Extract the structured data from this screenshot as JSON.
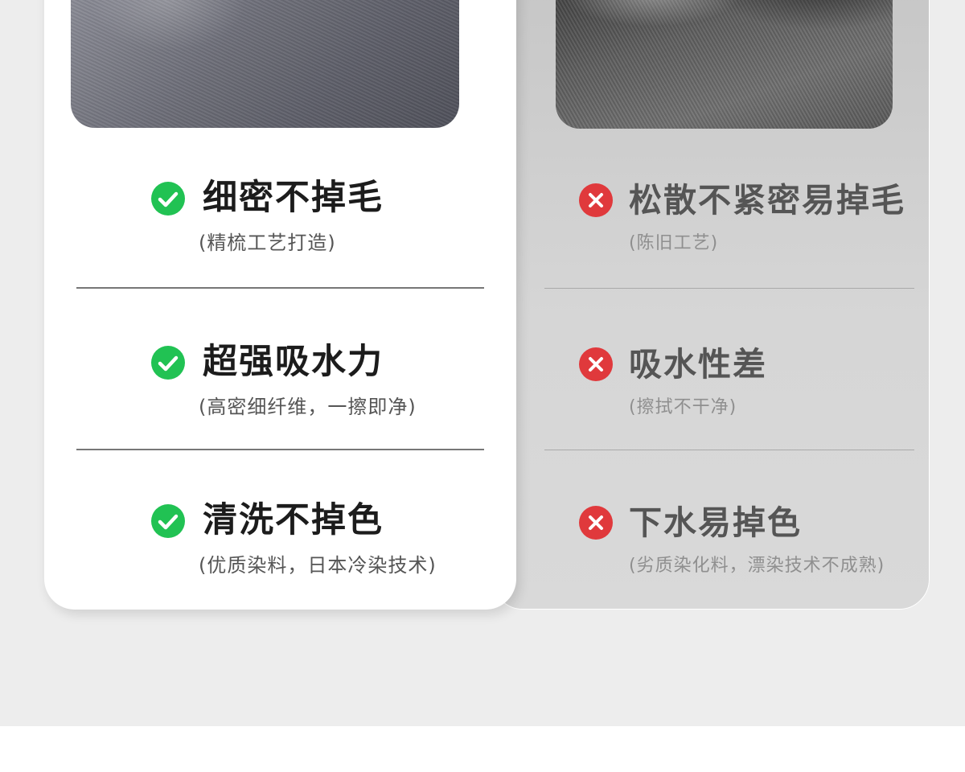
{
  "good": {
    "rows": [
      {
        "title": "细密不掉毛",
        "sub": "(精梳工艺打造)"
      },
      {
        "title": "超强吸水力",
        "sub": "(高密细纤维，一擦即净)"
      },
      {
        "title": "清洗不掉色",
        "sub": "(优质染料，日本冷染技术)"
      }
    ]
  },
  "bad": {
    "rows": [
      {
        "title": "松散不紧密易掉毛",
        "sub": "(陈旧工艺)"
      },
      {
        "title": "吸水性差",
        "sub": "(擦拭不干净)"
      },
      {
        "title": "下水易掉色",
        "sub": "(劣质染化料，漂染技术不成熟)"
      }
    ]
  },
  "colors": {
    "check": "#21c253",
    "cross": "#e0393c"
  },
  "icons": {
    "good": "check-circle-icon",
    "bad": "x-circle-icon"
  }
}
